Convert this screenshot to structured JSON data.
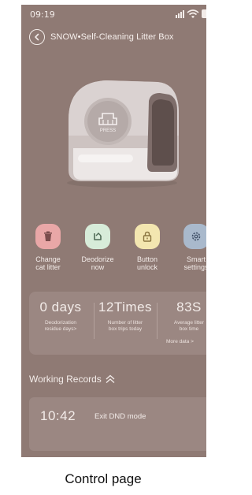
{
  "status_bar": {
    "time": "09:19"
  },
  "header": {
    "title": "SNOW•Self-Cleaning Litter Box"
  },
  "actions": [
    {
      "label_line1": "Change",
      "label_line2": "cat litter",
      "icon": "trash-icon",
      "color": "#e9a7a7"
    },
    {
      "label_line1": "Deodorize",
      "label_line2": "now",
      "icon": "refresh-icon",
      "color": "#d7ecd9"
    },
    {
      "label_line1": "Button",
      "label_line2": "unlock",
      "icon": "lock-icon",
      "color": "#f3e6b0"
    },
    {
      "label_line1": "Smart",
      "label_line2": "settings",
      "icon": "gear-icon",
      "color": "#a9b9cc"
    }
  ],
  "stats": [
    {
      "value": "0 days",
      "desc_line1": "Deodorization",
      "desc_line2": "residue days>"
    },
    {
      "value": "12Times",
      "desc_line1": "Number of litter",
      "desc_line2": "box trips today"
    },
    {
      "value": "83S",
      "desc_line1": "Average litter",
      "desc_line2": "box time"
    }
  ],
  "more_data": "More data >",
  "records": {
    "title": "Working Records",
    "items": [
      {
        "time": "10:42",
        "event": "Exit DND mode"
      }
    ]
  },
  "device": {
    "press_label": "PRESS"
  },
  "caption": "Control page"
}
